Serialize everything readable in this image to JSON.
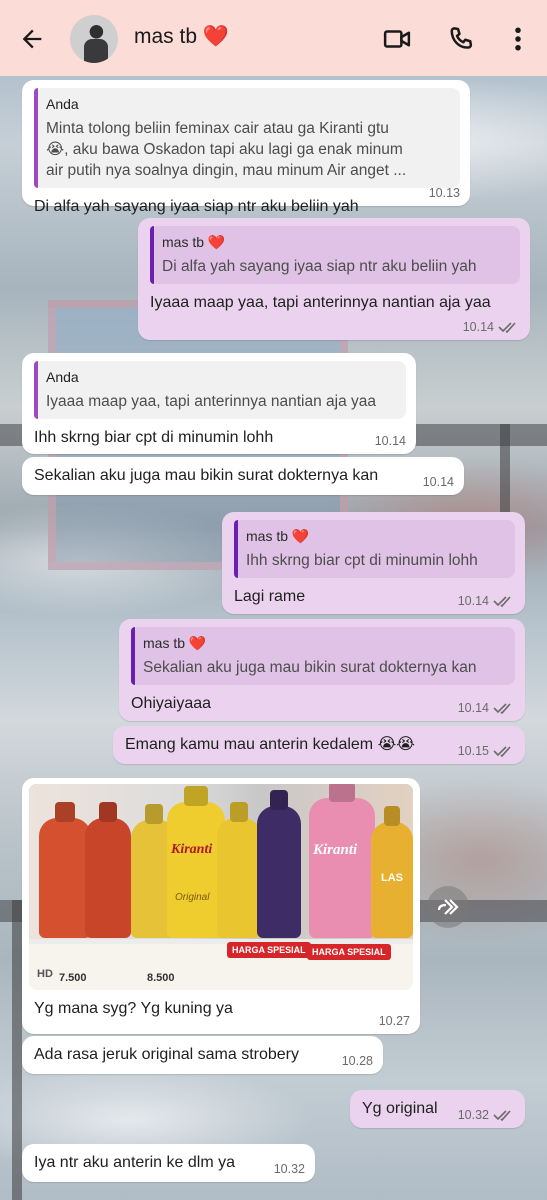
{
  "header": {
    "contact_name": "mas tb",
    "heart": "❤️",
    "icons": [
      "back-arrow-icon",
      "video-call-icon",
      "phone-icon",
      "more-vert-icon"
    ]
  },
  "colors": {
    "header_bg": "#fcdcd7",
    "outgoing_bubble": "#ebd3ef",
    "incoming_bubble": "#ffffff"
  },
  "messages": [
    {
      "direction": "in",
      "quote_author": "Anda",
      "quote_text_1": "Minta tolong beliin feminax cair atau ga Kiranti gtu",
      "quote_text_2": "😭, aku bawa Oskadon tapi aku lagi ga enak minum",
      "quote_text_3": "air putih nya soalnya dingin, mau minum Air anget ...",
      "text": "Di alfa yah sayang iyaa siap ntr aku beliin yah",
      "time": "10.13"
    },
    {
      "direction": "out",
      "quote_author": "mas tb",
      "quote_text": "Di alfa yah sayang iyaa siap ntr aku beliin yah",
      "text": "Iyaaa maap yaa, tapi anterinnya nantian aja yaa",
      "time": "10.14"
    },
    {
      "direction": "in",
      "quote_author": "Anda",
      "quote_text": "Iyaaa maap yaa, tapi anterinnya nantian aja yaa",
      "text": "Ihh skrng biar cpt di minumin lohh",
      "time": "10.14"
    },
    {
      "direction": "in",
      "text": "Sekalian aku juga mau bikin surat dokternya kan",
      "time": "10.14"
    },
    {
      "direction": "out",
      "quote_author": "mas tb",
      "quote_text": "Ihh skrng biar cpt di minumin lohh",
      "text": "Lagi rame",
      "time": "10.14"
    },
    {
      "direction": "out",
      "quote_author": "mas tb",
      "quote_text": "Sekalian aku juga mau bikin surat dokternya kan",
      "text": "Ohiyaiyaaa",
      "time": "10.14"
    },
    {
      "direction": "out",
      "text": "Emang kamu mau anterin kedalem 😭😭",
      "time": "10.15"
    },
    {
      "direction": "in",
      "image": {
        "brand": "Kiranti",
        "label_original": "Original",
        "label_lasegar": "LAS",
        "tag_1": "HARGA SPESIAL",
        "tag_2": "HARGA SPESIAL",
        "price_1": "7.500",
        "price_2": "8.500",
        "tag_hd": "HD"
      },
      "text": "Yg mana syg? Yg kuning ya",
      "time": "10.27"
    },
    {
      "direction": "in",
      "text": "Ada rasa jeruk original sama strobery",
      "time": "10.28"
    },
    {
      "direction": "out",
      "text": "Yg original",
      "time": "10.32"
    },
    {
      "direction": "in",
      "text": "Iya ntr aku anterin ke dlm ya",
      "time": "10.32"
    }
  ]
}
